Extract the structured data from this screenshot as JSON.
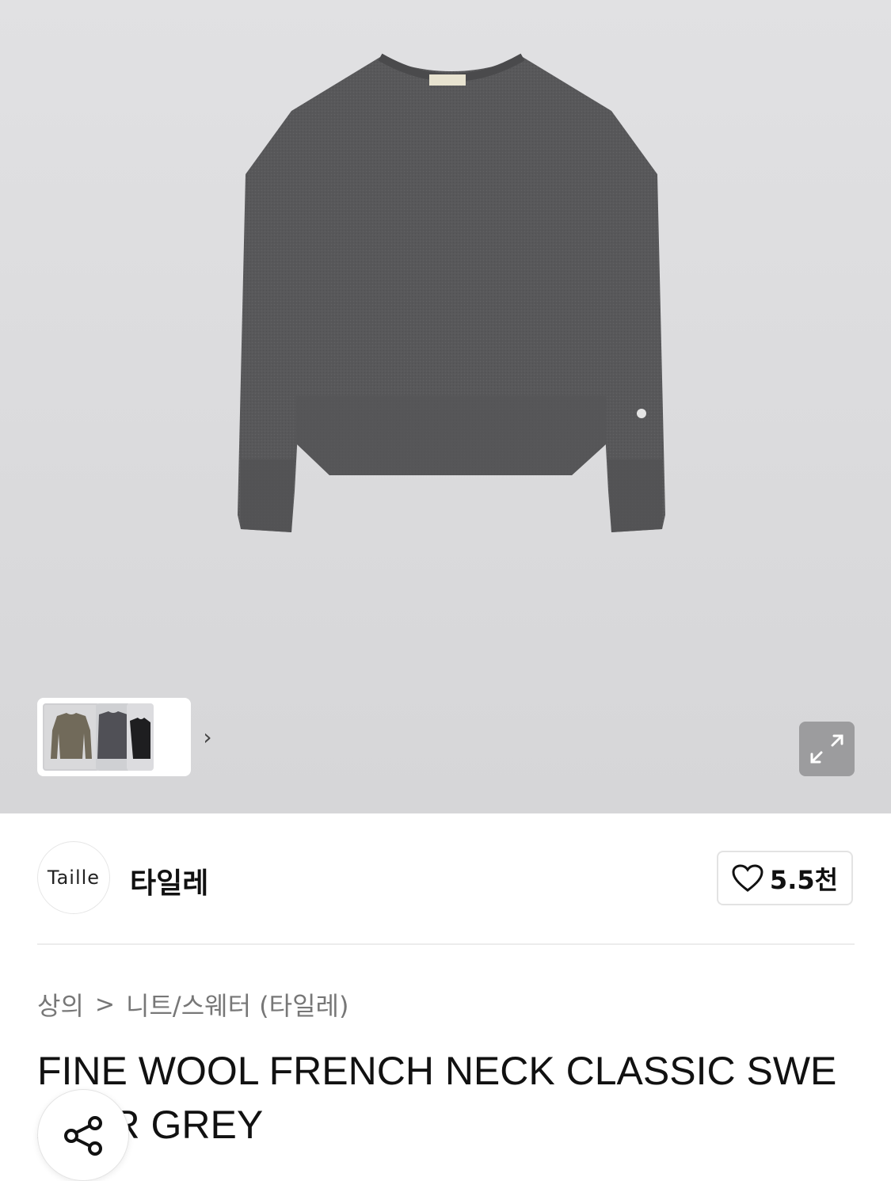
{
  "gallery": {
    "thumbnails": [
      "olive-sweater-thumb",
      "grey-sweater-thumb",
      "black-sweater-thumb"
    ],
    "next_icon": "chevron-right-icon",
    "expand_icon": "expand-icon"
  },
  "brand": {
    "logo_text": "Taille",
    "name": "타일레",
    "like_icon": "heart-icon",
    "like_count": "5.5천"
  },
  "breadcrumb": {
    "level1": "상의",
    "separator": ">",
    "level2": "니트/스웨터 (타일레)"
  },
  "product": {
    "title": "FINE WOOL FRENCH NECK CLASSIC SWEATER GREY"
  },
  "share": {
    "icon": "share-icon"
  },
  "colors": {
    "sweater": "#58585a",
    "expand_button": "#9c9c9e",
    "hero_background": "#dcdcde"
  }
}
